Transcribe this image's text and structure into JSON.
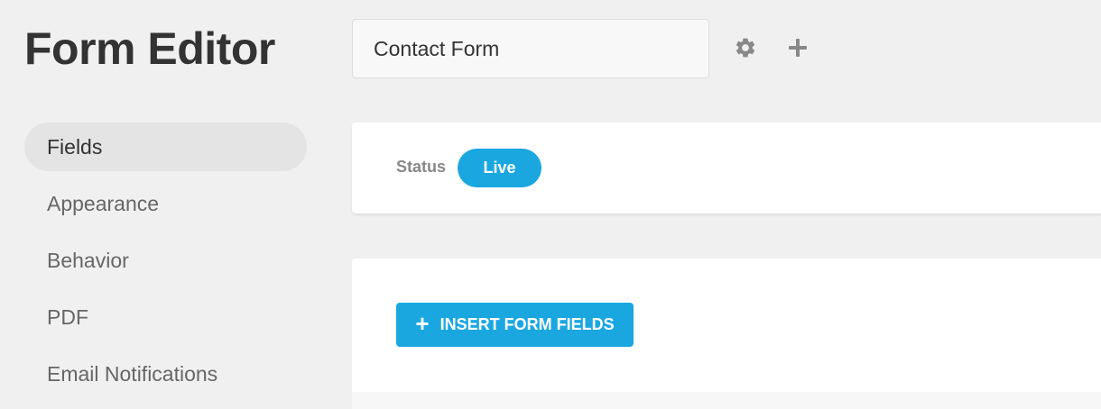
{
  "header": {
    "title": "Form Editor",
    "form_name_value": "Contact Form",
    "settings_icon": "gear-icon",
    "add_icon": "plus-icon"
  },
  "sidebar": {
    "items": [
      {
        "label": "Fields",
        "active": true
      },
      {
        "label": "Appearance",
        "active": false
      },
      {
        "label": "Behavior",
        "active": false
      },
      {
        "label": "PDF",
        "active": false
      },
      {
        "label": "Email Notifications",
        "active": false
      }
    ]
  },
  "status": {
    "label": "Status",
    "value": "Live"
  },
  "fields": {
    "insert_button_label": "INSERT FORM FIELDS",
    "insert_button_icon": "+"
  },
  "colors": {
    "accent": "#1aa7e0",
    "background": "#f0f0f0",
    "card": "#ffffff",
    "title_text": "#333333",
    "muted_text": "#888888",
    "icon": "#888888"
  }
}
